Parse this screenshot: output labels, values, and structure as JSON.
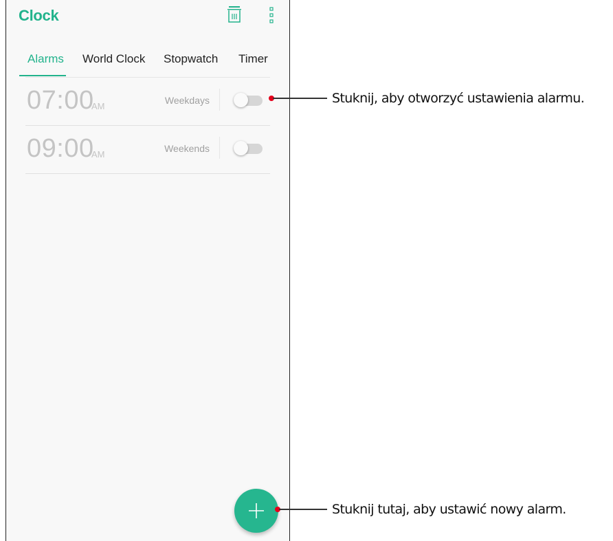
{
  "app": {
    "title": "Clock",
    "accent_color": "#22b38c"
  },
  "toolbar": {
    "delete_icon": "trash-icon",
    "more_icon": "more-vertical-icon"
  },
  "tabs": [
    {
      "label": "Alarms",
      "active": true
    },
    {
      "label": "World Clock",
      "active": false
    },
    {
      "label": "Stopwatch",
      "active": false
    },
    {
      "label": "Timer",
      "active": false
    }
  ],
  "alarms": [
    {
      "time": "07:00",
      "ampm": "AM",
      "repeat": "Weekdays",
      "enabled": false
    },
    {
      "time": "09:00",
      "ampm": "AM",
      "repeat": "Weekends",
      "enabled": false
    }
  ],
  "fab": {
    "icon": "plus-icon"
  },
  "callouts": [
    {
      "text": "Stuknij, aby otworzyć ustawienia alarmu."
    },
    {
      "text": "Stuknij tutaj, aby ustawić nowy alarm."
    }
  ]
}
